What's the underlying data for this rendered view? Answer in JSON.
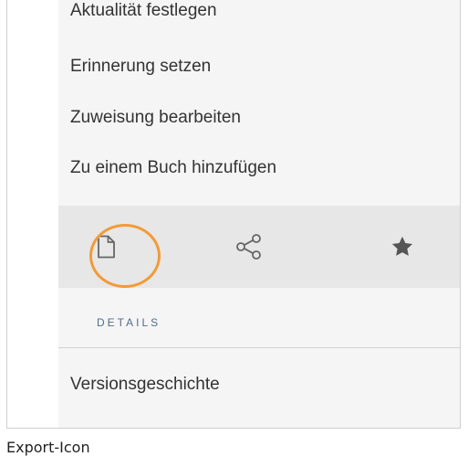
{
  "menu": {
    "items": [
      {
        "label": "Aktualität festlegen"
      },
      {
        "label": "Erinnerung setzen"
      },
      {
        "label": "Zuweisung bearbeiten"
      },
      {
        "label": "Zu einem Buch hinzufügen"
      }
    ]
  },
  "icon_bar": {
    "icons": [
      {
        "name": "document-icon"
      },
      {
        "name": "share-icon"
      },
      {
        "name": "star-icon"
      }
    ],
    "highlight_color": "#f29b38"
  },
  "details": {
    "heading": "DETAILS",
    "items": [
      {
        "label": "Versionsgeschichte"
      }
    ]
  },
  "caption": "Export-Icon"
}
